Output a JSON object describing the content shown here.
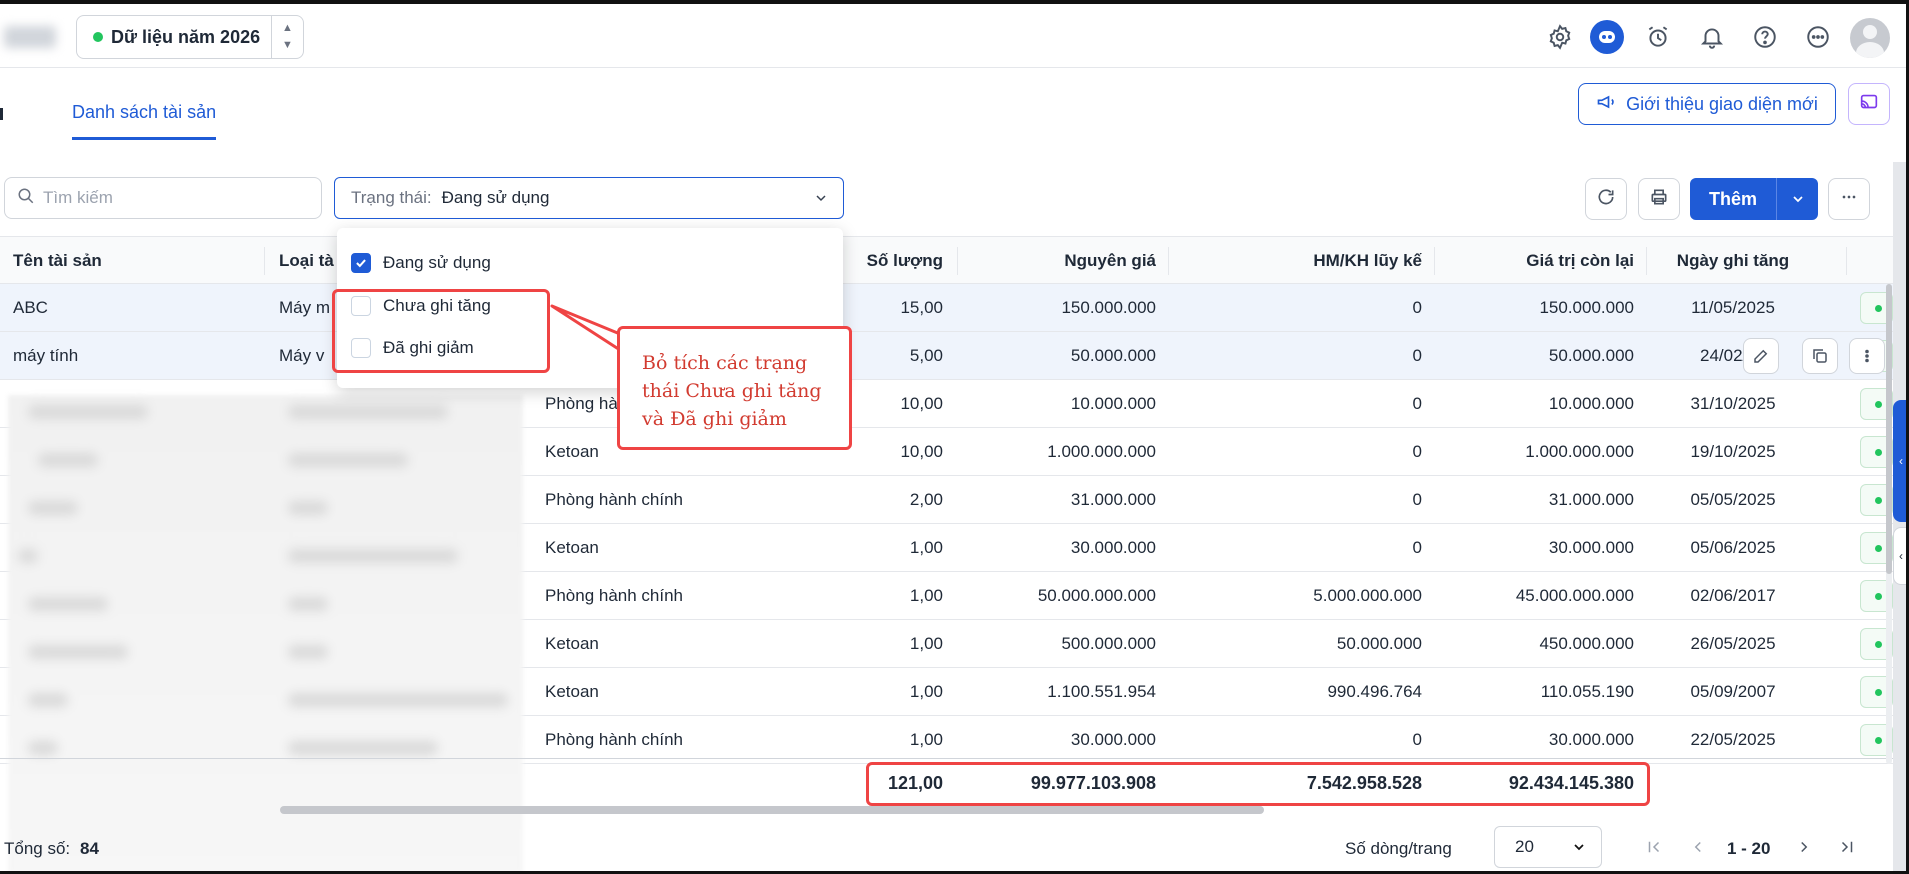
{
  "topbar": {
    "year_label": "Dữ liệu năm 2026",
    "year_dot_color": "#22c55e",
    "icons": [
      "gear-icon",
      "assistant-bot-icon",
      "alarm-clock-icon",
      "bell-icon",
      "help-icon",
      "more-circle-icon"
    ]
  },
  "tabs": {
    "active": "Danh sách tài sản",
    "intro_button": "Giới thiệu giao diện mới"
  },
  "toolbar": {
    "search_placeholder": "Tìm kiếm",
    "status_label": "Trạng thái:",
    "status_value": "Đang sử dụng",
    "add_label": "Thêm"
  },
  "dropdown": {
    "options": [
      {
        "label": "Đang sử dụng",
        "checked": true
      },
      {
        "label": "Chưa ghi tăng",
        "checked": false
      },
      {
        "label": "Đã ghi giảm",
        "checked": false
      }
    ]
  },
  "callout": {
    "line1": "Bỏ tích các trạng",
    "line2": "thái Chưa ghi tăng",
    "line3": "và Đã ghi giảm",
    "color": "#ef4444"
  },
  "table": {
    "headers": {
      "name": "Tên tài sản",
      "type": "Loại tà",
      "qty": "Số lượng",
      "cost": "Nguyên giá",
      "depr": "HM/KH lũy kế",
      "remain": "Giá trị còn lại",
      "date": "Ngày ghi tăng"
    },
    "rows": [
      {
        "name": "ABC",
        "type": "Máy m",
        "dept": "",
        "qty": "15,00",
        "cost": "150.000.000",
        "depr": "0",
        "remain": "150.000.000",
        "date": "11/05/2025"
      },
      {
        "name": "máy tính",
        "type": "Máy v",
        "dept": "",
        "qty": "5,00",
        "cost": "50.000.000",
        "depr": "0",
        "remain": "50.000.000",
        "date": "24/02/"
      },
      {
        "name": "",
        "type": "",
        "dept": "Phòng hà",
        "qty": "10,00",
        "cost": "10.000.000",
        "depr": "0",
        "remain": "10.000.000",
        "date": "31/10/2025"
      },
      {
        "name": "",
        "type": "",
        "dept": "Ketoan",
        "qty": "10,00",
        "cost": "1.000.000.000",
        "depr": "0",
        "remain": "1.000.000.000",
        "date": "19/10/2025"
      },
      {
        "name": "",
        "type": "",
        "dept": "Phòng hành chính",
        "qty": "2,00",
        "cost": "31.000.000",
        "depr": "0",
        "remain": "31.000.000",
        "date": "05/05/2025"
      },
      {
        "name": "",
        "type": "",
        "dept": "Ketoan",
        "qty": "1,00",
        "cost": "30.000.000",
        "depr": "0",
        "remain": "30.000.000",
        "date": "05/06/2025"
      },
      {
        "name": "",
        "type": "",
        "dept": "Phòng hành chính",
        "qty": "1,00",
        "cost": "50.000.000.000",
        "depr": "5.000.000.000",
        "remain": "45.000.000.000",
        "date": "02/06/2017"
      },
      {
        "name": "",
        "type": "",
        "dept": "Ketoan",
        "qty": "1,00",
        "cost": "500.000.000",
        "depr": "50.000.000",
        "remain": "450.000.000",
        "date": "26/05/2025"
      },
      {
        "name": "",
        "type": "",
        "dept": "Ketoan",
        "qty": "1,00",
        "cost": "1.100.551.954",
        "depr": "990.496.764",
        "remain": "110.055.190",
        "date": "05/09/2007"
      },
      {
        "name": "",
        "type": "",
        "dept": "Phòng hành chính",
        "qty": "1,00",
        "cost": "30.000.000",
        "depr": "0",
        "remain": "30.000.000",
        "date": "22/05/2025"
      }
    ],
    "totals": {
      "qty": "121,00",
      "cost": "99.977.103.908",
      "depr": "7.542.958.528",
      "remain": "92.434.145.380"
    }
  },
  "footer": {
    "total_label": "Tổng số:",
    "total_value": "84",
    "rows_per_page_label": "Số dòng/trang",
    "rows_per_page_value": "20",
    "page_range": "1 - 20"
  }
}
